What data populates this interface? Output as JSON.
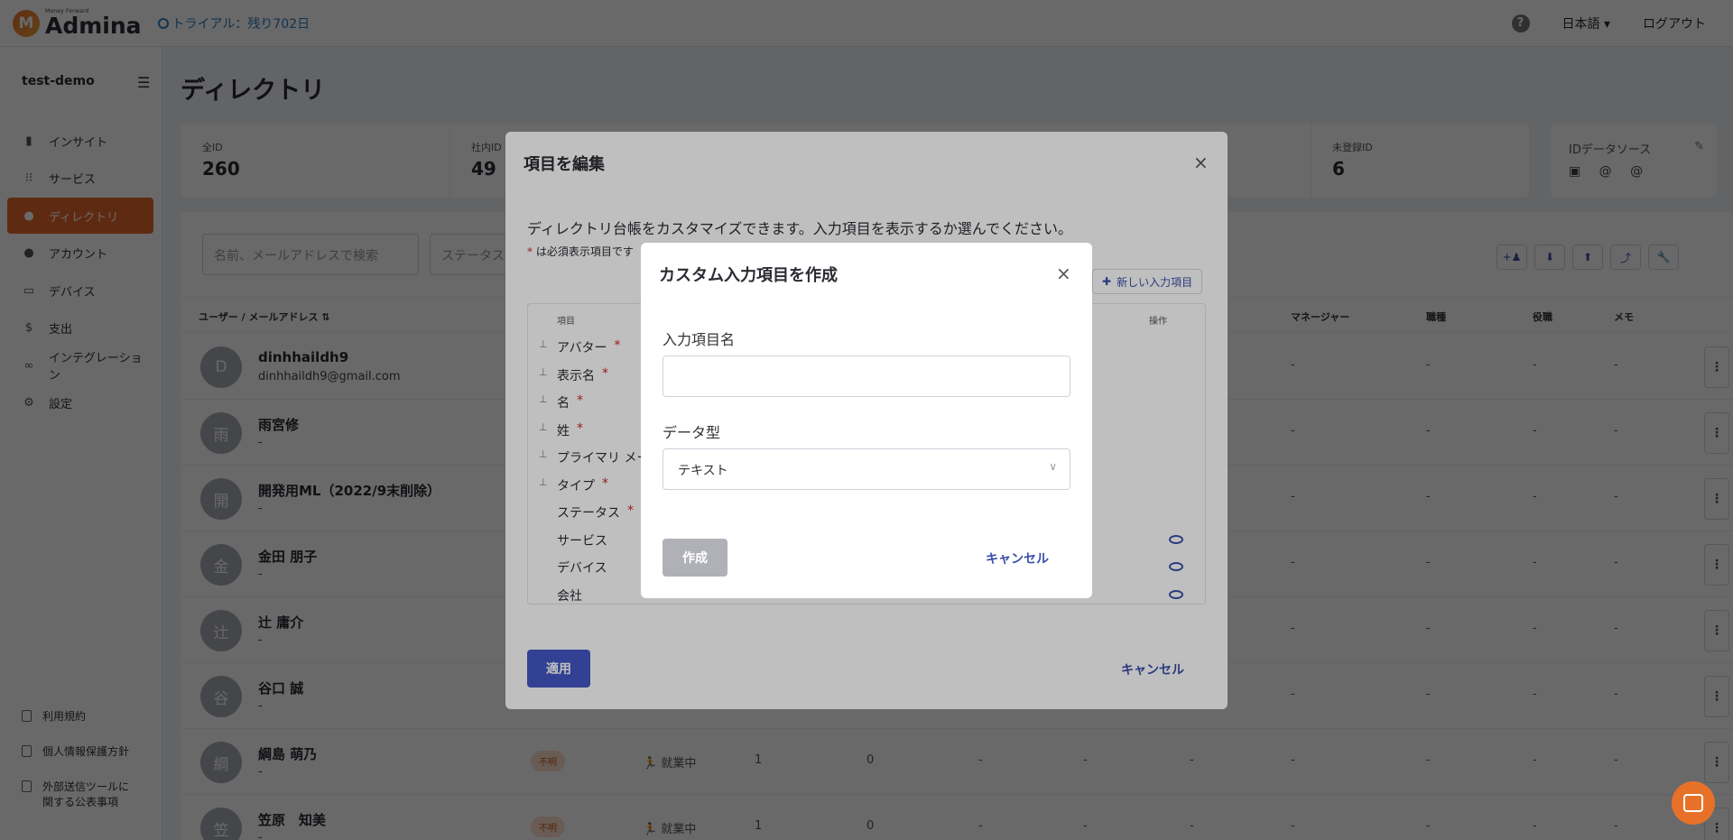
{
  "header": {
    "logo_sub": "Money Forward",
    "logo_name": "Admina",
    "trial": "トライアル：残り702日",
    "language": "日本語",
    "logout": "ログアウト"
  },
  "sidebar": {
    "tenant": "test-demo",
    "items": [
      {
        "label": "インサイト",
        "icon": "chart-icon"
      },
      {
        "label": "サービス",
        "icon": "grid-icon"
      },
      {
        "label": "ディレクトリ",
        "icon": "users-icon",
        "active": true
      },
      {
        "label": "アカウント",
        "icon": "users-icon"
      },
      {
        "label": "デバイス",
        "icon": "laptop-icon"
      },
      {
        "label": "支出",
        "icon": "dollar-icon"
      },
      {
        "label": "インテグレーション",
        "icon": "link-icon"
      },
      {
        "label": "設定",
        "icon": "gear-icon"
      }
    ],
    "footer": [
      {
        "label": "利用規約"
      },
      {
        "label": "個人情報保護方針"
      },
      {
        "label": "外部送信ツールに関する公表事項"
      }
    ]
  },
  "page": {
    "title": "ディレクトリ",
    "stats": [
      {
        "label": "全ID",
        "value": "260"
      },
      {
        "label": "社内ID",
        "value": "49"
      },
      {
        "label": "未登録ID",
        "value": "6"
      }
    ],
    "id_source_label": "IDデータソース",
    "search_placeholder": "名前、メールアドレスで検索",
    "status_placeholder": "ステータス"
  },
  "table": {
    "headers": {
      "user": "ユーザー / メールアドレス",
      "manager": "マネージャー",
      "job": "職種",
      "position": "役職",
      "memo": "メモ"
    },
    "rows": [
      {
        "initial": "D",
        "name": "dinhhaildh9",
        "sub": "dinhhaildh9@gmail.com"
      },
      {
        "initial": "雨",
        "name": "雨宮修",
        "sub": "-"
      },
      {
        "initial": "開",
        "name": "開発用ML（2022/9末削除）",
        "sub": "-"
      },
      {
        "initial": "金",
        "name": "金田 朋子",
        "sub": "-"
      },
      {
        "initial": "辻",
        "name": "辻 庸介",
        "sub": "-"
      },
      {
        "initial": "谷",
        "name": "谷口 誠",
        "sub": "-"
      },
      {
        "initial": "綱",
        "name": "綱島 萌乃",
        "sub": "-",
        "badge": "不明",
        "status": "就業中",
        "n1": "1",
        "n2": "0"
      },
      {
        "initial": "笠",
        "name": "笠原　知美",
        "sub": "-",
        "badge": "不明",
        "status": "就業中",
        "n1": "1",
        "n2": "0"
      }
    ],
    "dash": "-"
  },
  "edit_modal": {
    "title": "項目を編集",
    "description": "ディレクトリ台帳をカスタマイズできます。入力項目を表示するか選んでください。",
    "required_note": "は必須表示項目です",
    "new_item": "新しい入力項目",
    "col_item": "項目",
    "col_action": "操作",
    "fields": [
      {
        "label": "アバター",
        "required": true,
        "pinned": true
      },
      {
        "label": "表示名",
        "required": true,
        "pinned": true
      },
      {
        "label": "名",
        "required": true,
        "pinned": true
      },
      {
        "label": "姓",
        "required": true,
        "pinned": true
      },
      {
        "label": "プライマリ メー",
        "required": false,
        "pinned": true
      },
      {
        "label": "タイプ",
        "required": true,
        "pinned": true
      },
      {
        "label": "ステータス",
        "required": true,
        "pinned": false
      },
      {
        "label": "サービス",
        "required": false,
        "pinned": false,
        "eye": true
      },
      {
        "label": "デバイス",
        "required": false,
        "pinned": false,
        "eye": true
      },
      {
        "label": "会社",
        "required": false,
        "pinned": false,
        "eye": true
      }
    ],
    "apply": "適用",
    "cancel": "キャンセル"
  },
  "create_modal": {
    "title": "カスタム入力項目を作成",
    "name_label": "入力項目名",
    "name_value": "",
    "type_label": "データ型",
    "type_value": "テキスト",
    "create": "作成",
    "cancel": "キャンセル"
  },
  "colors": {
    "accent": "#e8692c",
    "primary": "#4357c6",
    "link": "#3a4fa8",
    "disabled": "#b0b1b6"
  }
}
